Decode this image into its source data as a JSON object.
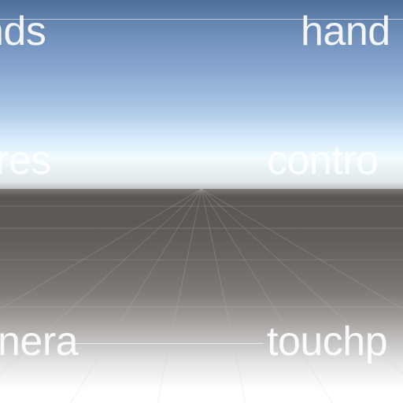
{
  "viewport": {
    "labels": {
      "top_left": "nds",
      "top_right": "hand",
      "middle_left": "res",
      "middle_right": "contro",
      "bottom_left": "nera",
      "bottom_right": "touchp"
    }
  },
  "colors": {
    "sky_top": "#4e6f99",
    "sky_mid": "#8aa8d1",
    "horizon_glow": "#f3fbff",
    "ground_dark": "#5a5552",
    "ground_light": "#ffffff",
    "label_text": "#ffffff"
  }
}
